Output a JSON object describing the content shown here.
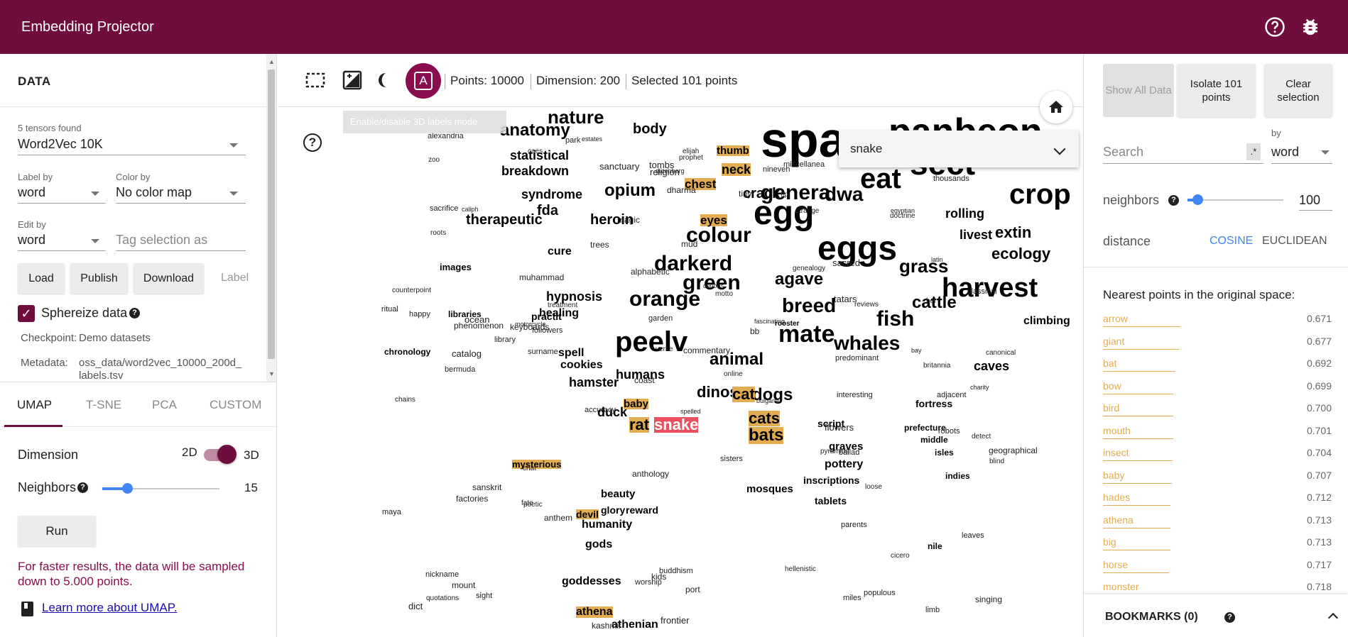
{
  "header": {
    "title": "Embedding Projector",
    "icons": [
      "help-icon",
      "bug-icon"
    ]
  },
  "data_panel": {
    "title": "DATA",
    "tensors_found": "5 tensors found",
    "tensor": "Word2Vec 10K",
    "label_by_label": "Label by",
    "label_by_value": "word",
    "color_by_label": "Color by",
    "color_by_value": "No color map",
    "edit_by_label": "Edit by",
    "edit_by_value": "word",
    "tag_placeholder": "Tag selection as",
    "buttons": {
      "load": "Load",
      "publish": "Publish",
      "download": "Download",
      "label": "Label"
    },
    "sphereize_label": "Sphereize data",
    "sphereize_checked": true,
    "checkpoint_key": "Checkpoint:",
    "checkpoint_val": "Demo datasets",
    "metadata_key": "Metadata:",
    "metadata_val_1": "oss_data/word2vec_10000_200d_",
    "metadata_val_2": "labels.tsv"
  },
  "projection_tabs": [
    "UMAP",
    "T-SNE",
    "PCA",
    "CUSTOM"
  ],
  "umap": {
    "dimension_label": "Dimension",
    "opt_2d": "2D",
    "opt_3d": "3D",
    "selected_dimension": "3D",
    "neighbors_label": "Neighbors",
    "neighbors_value": "15",
    "neighbors_fraction": 0.22,
    "run_label": "Run",
    "note": "For faster results, the data will be sampled down to 5.000 points.",
    "learn_more": "Learn more about UMAP."
  },
  "toolbar": {
    "points": "Points: 10000",
    "dimension": "Dimension: 200",
    "selected": "Selected 101 points",
    "label3d_letter": "A",
    "tooltip": "Enable/disable 3D labels mode",
    "search_value": "snake",
    "icons": [
      "select-rectangle-icon",
      "night-mode-icon",
      "theme-icon",
      "label-3d-icon",
      "home-icon"
    ]
  },
  "right_panel": {
    "show_all": "Show All Data",
    "isolate": "Isolate 101 points",
    "clear": "Clear selection",
    "search_placeholder": "Search",
    "regex": ".*",
    "by_label": "by",
    "by_value": "word",
    "neighbors_label": "neighbors",
    "neighbors_value": "100",
    "neighbors_fraction": 0.1,
    "distance_label": "distance",
    "cosine": "COSINE",
    "euclidean": "EUCLIDEAN",
    "selected_distance": "COSINE",
    "nn_title": "Nearest points in the original space:",
    "neighbors": [
      {
        "word": "arrow",
        "value": "0.671"
      },
      {
        "word": "giant",
        "value": "0.677"
      },
      {
        "word": "bat",
        "value": "0.692"
      },
      {
        "word": "bow",
        "value": "0.699"
      },
      {
        "word": "bird",
        "value": "0.700"
      },
      {
        "word": "mouth",
        "value": "0.701"
      },
      {
        "word": "insect",
        "value": "0.704"
      },
      {
        "word": "baby",
        "value": "0.707"
      },
      {
        "word": "hades",
        "value": "0.712"
      },
      {
        "word": "athena",
        "value": "0.713"
      },
      {
        "word": "big",
        "value": "0.713"
      },
      {
        "word": "horse",
        "value": "0.717"
      },
      {
        "word": "monster",
        "value": "0.718"
      }
    ],
    "bookmarks": "BOOKMARKS (0)"
  },
  "cloud": {
    "selected_word": "snake",
    "big_words": [
      "spa",
      "panbeon",
      "sect",
      "eat",
      "eggs",
      "egg",
      "crop",
      "harvest",
      "genera",
      "colour",
      "darkerd",
      "green",
      "orange",
      "peelv",
      "mate",
      "breed",
      "fish",
      "whales",
      "dogs",
      "animal",
      "cats",
      "bats",
      "grass",
      "ecology",
      "anatomy",
      "nature",
      "body",
      "dwa",
      "agave",
      "cattle",
      "rolling",
      "extin",
      "livest",
      "opium",
      "therapeutic",
      "heroin",
      "hypnosis",
      "healing",
      "humans",
      "hamster",
      "cookies",
      "spell",
      "dinos",
      "caves",
      "climbing",
      "fortress",
      "script",
      "graves",
      "pottery",
      "inscriptions",
      "tablets",
      "mosques",
      "goddesses",
      "gods",
      "humanity",
      "beauty",
      "mysterious",
      "athena",
      "duck",
      "rat",
      "baby",
      "cat",
      "thumb",
      "neck",
      "chest",
      "eyes",
      "crack",
      "fda",
      "syndrome",
      "breakdown",
      "statistical",
      "images",
      "libraries",
      "chronology",
      "indies",
      "isles",
      "middle",
      "prefecture",
      "nile",
      "glory",
      "reward",
      "cure",
      "practit",
      "rooster",
      "athenian",
      "devil"
    ],
    "small_words": [
      "spelled",
      "surname",
      "nickname",
      "alphabetic",
      "miscellanea",
      "chat",
      "online",
      "dict",
      "catalog",
      "library",
      "genealogy",
      "canonical",
      "motto",
      "reviews",
      "quotations",
      "britannia",
      "bb",
      "ftp",
      "gutenberg",
      "anthology",
      "classical",
      "commentary",
      "verse",
      "poetic",
      "anthem",
      "singing",
      "ballad",
      "counterpoint",
      "keyboards",
      "sacred",
      "ritual",
      "religion",
      "buddhism",
      "dharma",
      "latin",
      "sanskrit",
      "hellenistic",
      "egyptian",
      "alexandria",
      "cicero",
      "elijah",
      "prophet",
      "muhammad",
      "caliph",
      "nineveh",
      "bermuda",
      "maya",
      "tatars",
      "pyramids",
      "sanctuary",
      "zoo",
      "park",
      "garden",
      "adjacent",
      "mount",
      "port",
      "frontier",
      "coast",
      "populous",
      "geographical",
      "tombs",
      "sisters",
      "parents",
      "kids",
      "happy",
      "blind",
      "strange",
      "curious",
      "charity",
      "magic",
      "fate",
      "robots",
      "doctrine",
      "worship",
      "sacrifice",
      "followers",
      "estates",
      "predominant",
      "thousands",
      "motorcycle",
      "factories",
      "chains",
      "trees",
      "mud",
      "limb",
      "leaves",
      "roots",
      "flowers",
      "treatment",
      "sight",
      "loose",
      "tiny",
      "detect",
      "accuracy",
      "phenomenon",
      "interesting",
      "fascinating",
      "ocean",
      "miles",
      "bay",
      "hel",
      "caes",
      "kashmir",
      "bulgaria"
    ]
  }
}
